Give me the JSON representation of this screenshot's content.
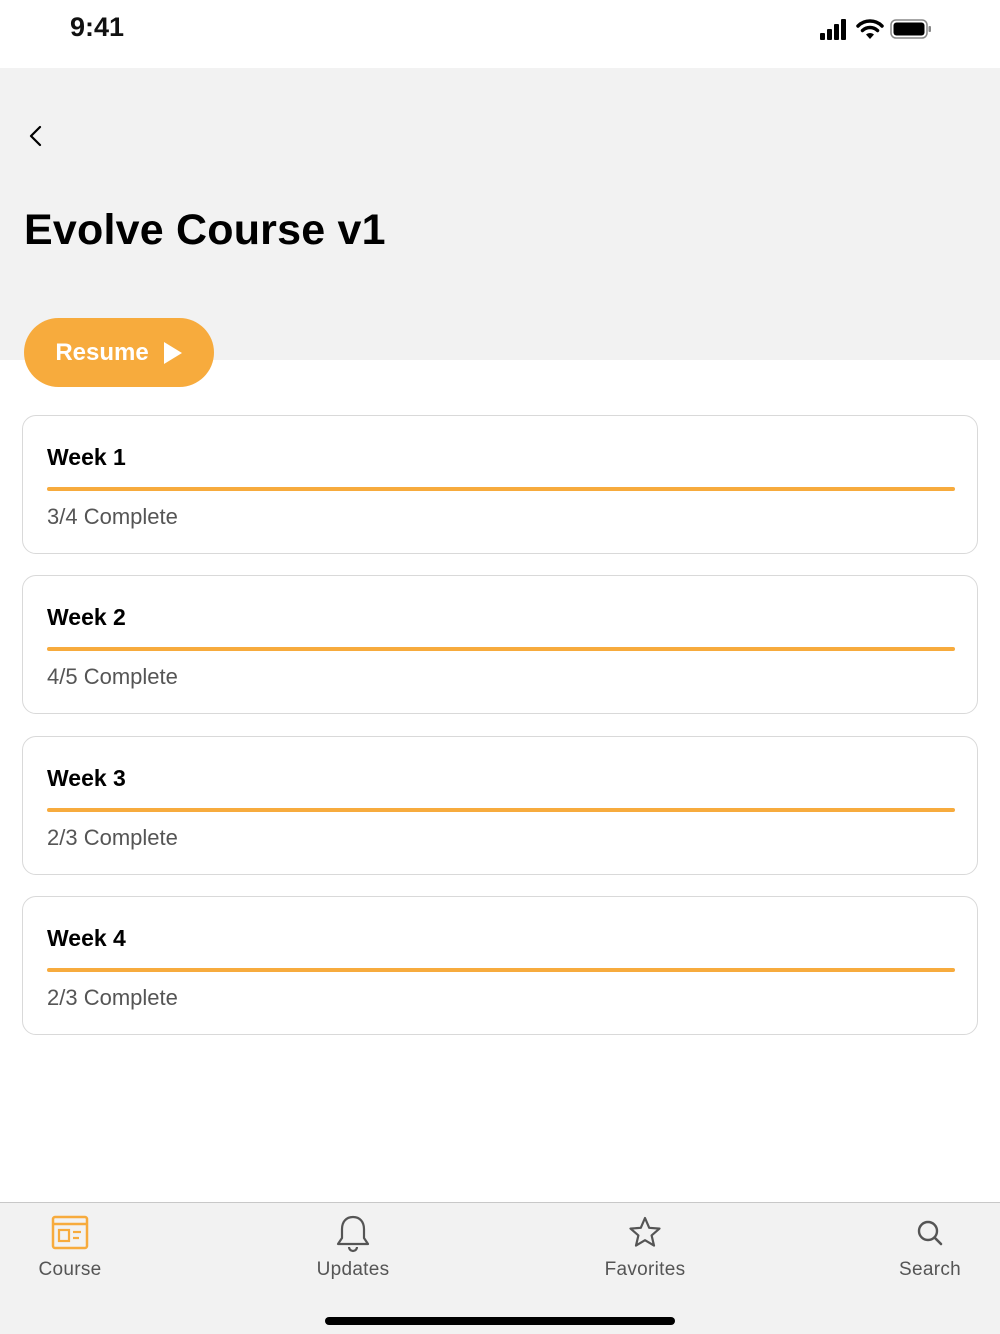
{
  "status_bar": {
    "time": "9:41"
  },
  "header": {
    "title": "Evolve Course v1"
  },
  "resume_button": {
    "label": "Resume"
  },
  "weeks": [
    {
      "title": "Week 1",
      "status": "3/4 Complete",
      "progress": 1.0
    },
    {
      "title": "Week 2",
      "status": "4/5 Complete",
      "progress": 1.0
    },
    {
      "title": "Week 3",
      "status": "2/3 Complete",
      "progress": 1.0
    },
    {
      "title": "Week 4",
      "status": "2/3 Complete",
      "progress": 1.0
    }
  ],
  "tab_bar": {
    "tabs": [
      {
        "label": "Course",
        "icon": "course-icon",
        "active": true
      },
      {
        "label": "Updates",
        "icon": "bell-icon",
        "active": false
      },
      {
        "label": "Favorites",
        "icon": "star-icon",
        "active": false
      },
      {
        "label": "Search",
        "icon": "search-icon",
        "active": false
      }
    ]
  },
  "colors": {
    "accent": "#f7ab3d",
    "header_bg": "#f2f2f2",
    "text_secondary": "#555555"
  }
}
